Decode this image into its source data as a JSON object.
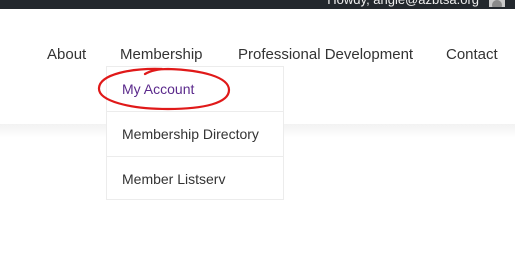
{
  "admin_bar": {
    "greeting": "Howdy, angie@azbtsa.org",
    "avatar_icon": "user-avatar-icon"
  },
  "nav": {
    "items": [
      {
        "label": "About"
      },
      {
        "label": "Membership"
      },
      {
        "label": "Professional Development"
      },
      {
        "label": "Contact"
      }
    ]
  },
  "membership_menu": {
    "items": [
      {
        "label": "My Account",
        "active": true
      },
      {
        "label": "Membership Directory"
      },
      {
        "label": "Member Listserv"
      }
    ]
  },
  "annotation": {
    "shape": "hand-drawn circle",
    "color": "#e01919",
    "target": "My Account"
  },
  "colors": {
    "admin_bar": "#23282d",
    "active_link": "#5b2a8c",
    "nav_text": "#333333"
  }
}
